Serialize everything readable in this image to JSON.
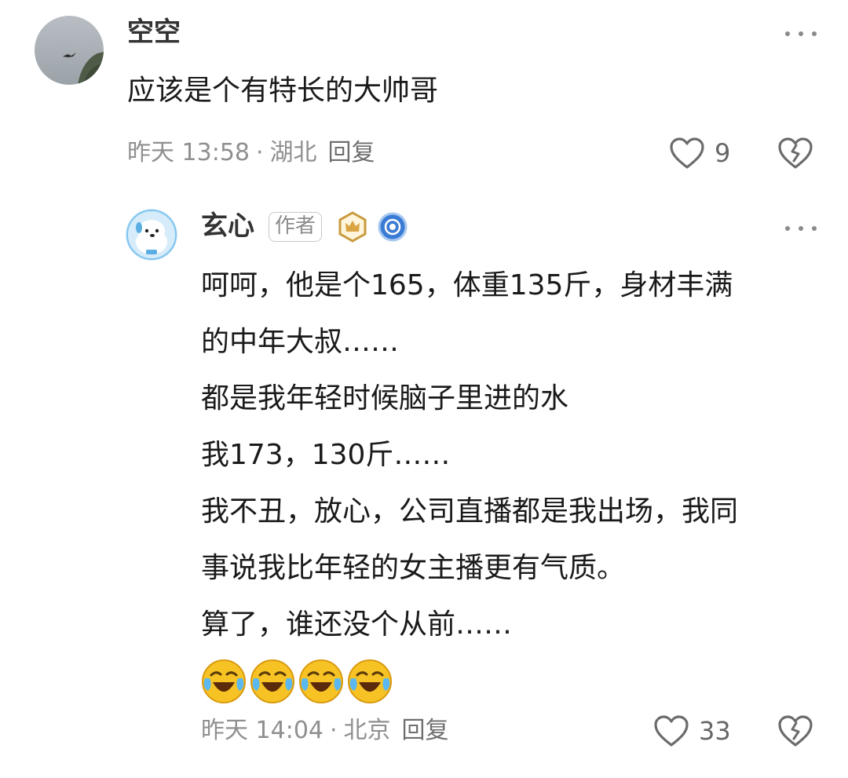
{
  "comment": {
    "username": "空空",
    "text": "应该是个有特长的大帅哥",
    "time": "昨天 13:58",
    "location": "湖北",
    "reply_label": "回复",
    "likes": "9",
    "avatar": "sky-bird-avatar"
  },
  "reply": {
    "username": "玄心",
    "author_label": "作者",
    "badges": [
      "crown-badge-icon",
      "circle-badge-icon"
    ],
    "lines": [
      "呵呵，他是个165，体重135斤，身材丰满",
      "的中年大叔……",
      "都是我年轻时候脑子里进的水",
      "我173，130斤……",
      "我不丑，放心，公司直播都是我出场，我同",
      "事说我比年轻的女主播更有气质。",
      "算了，谁还没个从前……"
    ],
    "emoji_count": 4,
    "emoji": "laugh-crying-emoji",
    "time": "昨天 14:04",
    "location": "北京",
    "reply_label": "回复",
    "likes": "33",
    "avatar": "white-dog-avatar"
  },
  "colors": {
    "text": "#1a1a1a",
    "meta": "#8f8f8f",
    "icon": "#6b6b6b",
    "badge_gold": "#c89b3c",
    "badge_blue": "#3a7bd5"
  }
}
